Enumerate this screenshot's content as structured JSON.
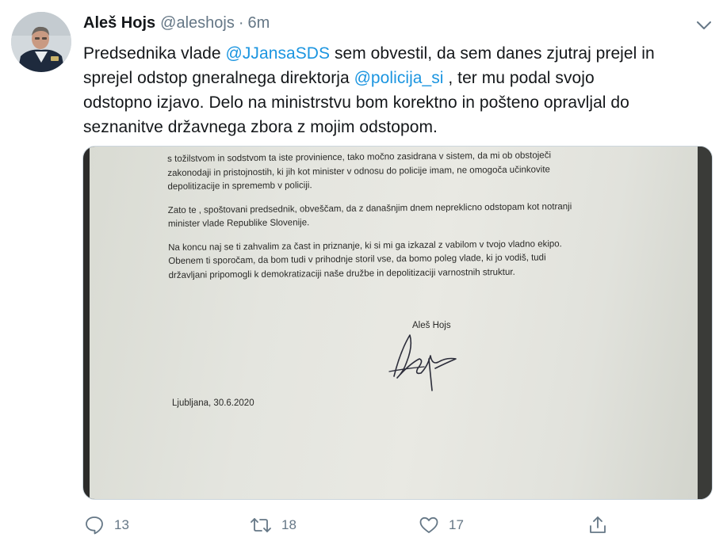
{
  "tweet": {
    "author_name": "Aleš Hojs",
    "author_handle": "@aleshojs",
    "separator": "·",
    "time": "6m",
    "text_lines": [
      [
        {
          "t": "Predsednika vlade ",
          "mention": false
        },
        {
          "t": "@JJansaSDS",
          "mention": true
        },
        {
          "t": " sem obvestil, da sem danes zjutraj prejel in",
          "mention": false
        }
      ],
      [
        {
          "t": "sprejel odstop gneralnega direktorja ",
          "mention": false
        },
        {
          "t": "@policija_si",
          "mention": true
        },
        {
          "t": " , ter mu podal svojo",
          "mention": false
        }
      ],
      [
        {
          "t": "odstopno izjavo. Delo na ministrstvu  bom korektno in pošteno opravljal do",
          "mention": false
        }
      ],
      [
        {
          "t": "seznanitve državnega zbora z mojim odstopom.",
          "mention": false
        }
      ]
    ]
  },
  "media": {
    "letter_lines": [
      "s tožilstvom in sodstvom ta iste provinience, tako močno zasidrana v sistem, da mi ob obstoječi",
      "zakonodaji in pristojnostih, ki jih kot minister v odnosu do policije imam, ne omogoča učinkovite",
      "depolitizacije in  sprememb v policiji.",
      "Zato te , spoštovani predsednik, obveščam, da z današnjim dnem nepreklicno odstopam kot notranji",
      "minister vlade Republike Slovenije.",
      "Na koncu naj se ti zahvalim za čast in priznanje, ki si mi ga izkazal z vabilom v tvojo vladno ekipo.",
      "Obenem ti sporočam, da bom tudi v prihodnje storil vse, da bomo poleg vlade, ki jo vodiš, tudi",
      "državljani pripomogli k demokratizaciji naše družbe in depolitizaciji varnostnih struktur."
    ],
    "signature_name": "Aleš Hojs",
    "date_line": "Ljubljana, 30.6.2020"
  },
  "actions": {
    "reply_count": "13",
    "retweet_count": "18",
    "like_count": "17"
  },
  "icons": {
    "reply": "reply-icon",
    "retweet": "retweet-icon",
    "like": "heart-icon",
    "share": "share-icon",
    "menu": "chevron-down-icon"
  },
  "colors": {
    "mention": "#1b95e0",
    "secondary_text": "#657786",
    "icon": "#657786"
  }
}
